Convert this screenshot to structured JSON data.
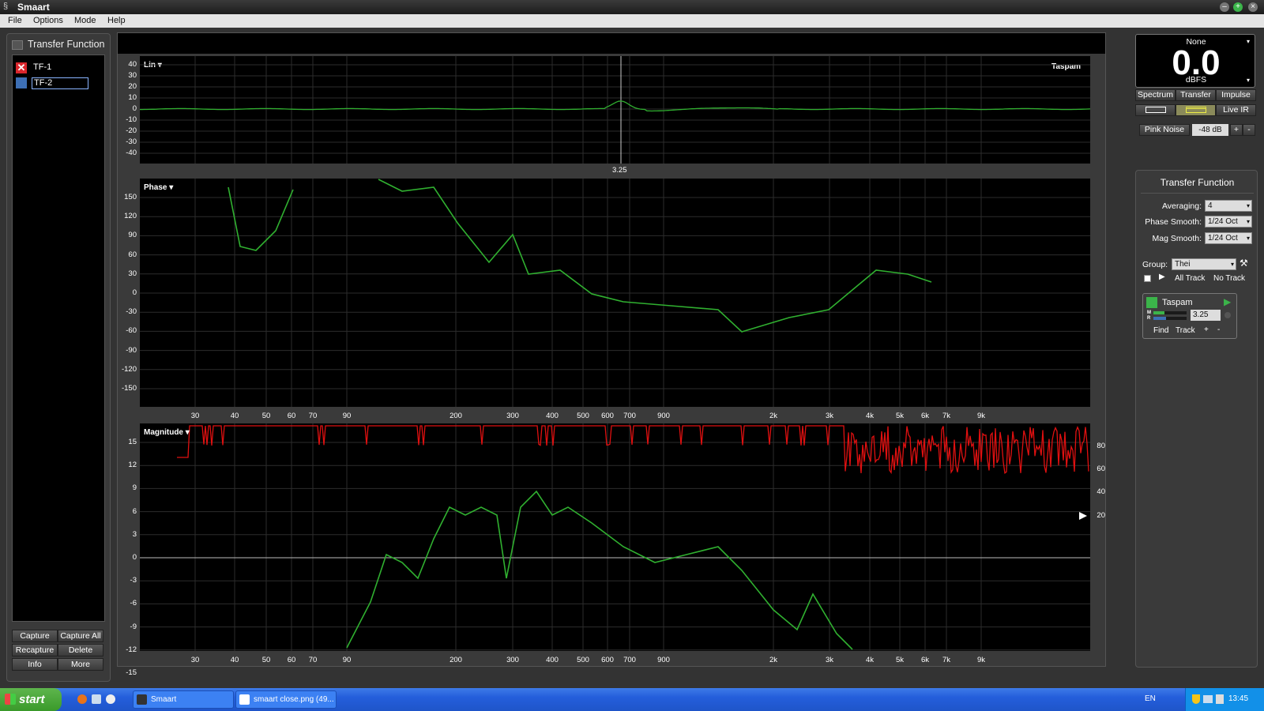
{
  "window": {
    "title": "Smaart"
  },
  "menu": [
    "File",
    "Options",
    "Mode",
    "Help"
  ],
  "left_panel": {
    "title": "Transfer Function",
    "items": [
      {
        "label": "TF-1",
        "color": "#d9262c"
      },
      {
        "label": "TF-2",
        "color": "#3d6fb5"
      }
    ],
    "buttons": [
      "Capture",
      "Capture All",
      "Recapture",
      "Delete",
      "Info",
      "More"
    ]
  },
  "impulse_plot": {
    "mode_label": "Lin ▾",
    "trace_name": "Taspam",
    "cursor_readout": "3.25",
    "y_ticks": [
      "40",
      "30",
      "20",
      "10",
      "0",
      "-10",
      "-20",
      "-30",
      "-40"
    ]
  },
  "phase_plot": {
    "label": "Phase ▾",
    "y_ticks": [
      "150",
      "120",
      "90",
      "60",
      "30",
      "0",
      "-30",
      "-60",
      "-90",
      "-120",
      "-150"
    ]
  },
  "magnitude_plot": {
    "label": "Magnitude ▾",
    "y_ticks": [
      "15",
      "12",
      "9",
      "6",
      "3",
      "0",
      "-3",
      "-6",
      "-9",
      "-12",
      "-15"
    ],
    "coherence_ticks": [
      "80",
      "60",
      "40",
      "20"
    ]
  },
  "x_ticks": [
    "30",
    "40",
    "50",
    "60",
    "70",
    "90",
    "200",
    "300",
    "400",
    "500",
    "600",
    "700",
    "900",
    "2k",
    "3k",
    "4k",
    "5k",
    "6k",
    "7k",
    "9k"
  ],
  "meter": {
    "source": "None",
    "value": "0.0",
    "unit": "dBFS"
  },
  "mode_tabs": [
    "Spectrum",
    "Transfer",
    "Impulse"
  ],
  "live_ir": "Live IR",
  "generator": {
    "label": "Pink Noise",
    "level": "-48 dB",
    "plus": "+",
    "minus": "-"
  },
  "tf_settings": {
    "title": "Transfer Function",
    "averaging": {
      "label": "Averaging:",
      "value": "4"
    },
    "phase_smooth": {
      "label": "Phase Smooth:",
      "value": "1/24 Oct"
    },
    "mag_smooth": {
      "label": "Mag Smooth:",
      "value": "1/24 Oct"
    },
    "group": {
      "label": "Group:",
      "value": "Thei"
    },
    "all_track": "All Track",
    "no_track": "No Track"
  },
  "measurement": {
    "name": "Taspam",
    "delay": "3.25",
    "m_label": "M",
    "r_label": "R",
    "find": "Find",
    "track": "Track",
    "plus": "+",
    "minus": "-"
  },
  "taskbar": {
    "start": "start",
    "items": [
      "Smaart",
      "smaart close.png (49..."
    ],
    "lang": "EN",
    "clock": "13:45"
  }
}
